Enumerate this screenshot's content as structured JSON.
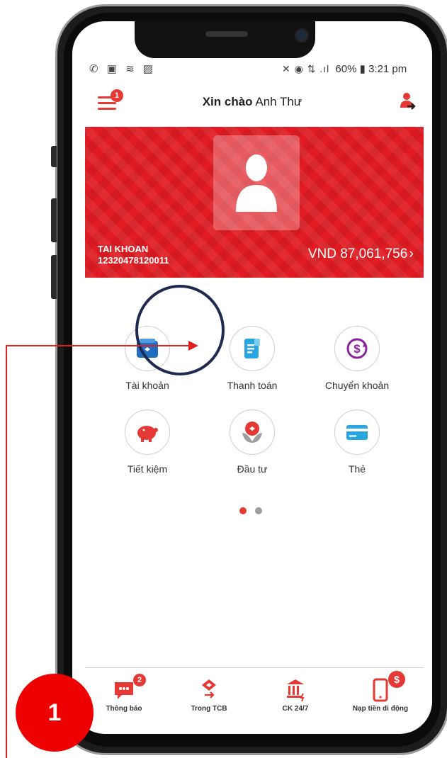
{
  "status_bar": {
    "left_icons": "✆ ▣ ≋ ▨",
    "right_icons": "✕ ◉ ⇅ .ıl",
    "battery": "60%",
    "time": "3:21 pm"
  },
  "header": {
    "greeting": "Xin chào",
    "user_name": "Anh Thư",
    "menu_badge_count": "1"
  },
  "account": {
    "label": "TAI KHOAN",
    "number": "12320478120011",
    "balance": "VND 87,061,756",
    "chevron": "›"
  },
  "features": [
    {
      "label": "Tài khoản",
      "icon": "wallet-icon",
      "color": "#1e6fc4"
    },
    {
      "label": "Thanh toán",
      "icon": "receipt-icon",
      "color": "#27a6e0"
    },
    {
      "label": "Chuyển khoản",
      "icon": "transfer-icon",
      "color": "#8e1fa3"
    },
    {
      "label": "Tiết kiệm",
      "icon": "piggy-bank-icon",
      "color": "#e53935"
    },
    {
      "label": "Đầu tư",
      "icon": "invest-icon",
      "color": "#e53935"
    },
    {
      "label": "Thẻ",
      "icon": "card-icon",
      "color": "#27a6e0"
    }
  ],
  "pager": {
    "active_color": "#e53935",
    "inactive_color": "#9e9e9e"
  },
  "bottom_nav": [
    {
      "label": "Thông báo",
      "icon": "chat-icon",
      "badge": "2"
    },
    {
      "label": "Trong TCB",
      "icon": "tcb-transfer-icon"
    },
    {
      "label": "CK 24/7",
      "icon": "bank-icon"
    },
    {
      "label": "Nạp tiền di động",
      "icon": "mobile-topup-icon",
      "badge": "$"
    }
  ],
  "annotation": {
    "step_number": "1"
  },
  "colors": {
    "brand_red": "#e11b22",
    "highlight_ring": "#1e2a50"
  }
}
